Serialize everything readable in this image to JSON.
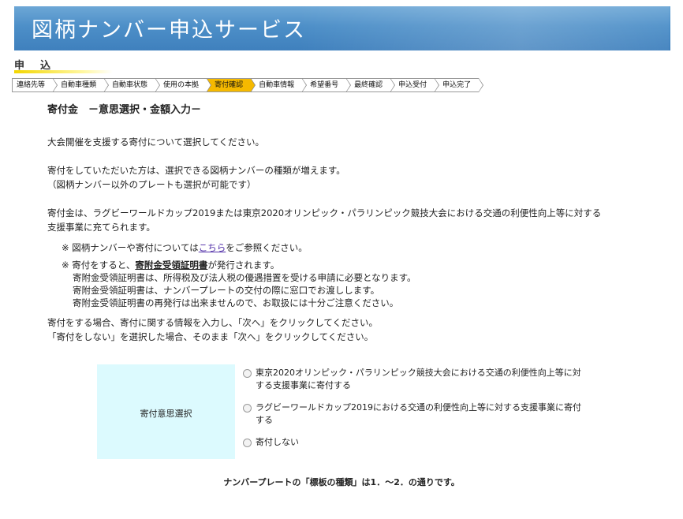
{
  "banner": {
    "title": "図柄ナンバー申込サービス"
  },
  "section": {
    "heading": "申込"
  },
  "steps": [
    {
      "label": "連絡先等",
      "active": false
    },
    {
      "label": "自動車種類",
      "active": false
    },
    {
      "label": "自動車状態",
      "active": false
    },
    {
      "label": "使用の本拠",
      "active": false
    },
    {
      "label": "寄付確認",
      "active": true
    },
    {
      "label": "自動車情報",
      "active": false
    },
    {
      "label": "希望番号",
      "active": false
    },
    {
      "label": "最終確認",
      "active": false
    },
    {
      "label": "申込受付",
      "active": false
    },
    {
      "label": "申込完了",
      "active": false
    }
  ],
  "content": {
    "title": "寄付金　－意思選択・金額入力－",
    "p1": "大会開催を支援する寄付について選択してください。",
    "p2a": "寄付をしていただいた方は、選択できる図柄ナンバーの種類が増えます。",
    "p2b": "（図柄ナンバー以外のプレートも選択が可能です）",
    "p3a": "寄付金は、ラグビーワールドカップ2019または東京2020オリンピック・パラリンピック競技大会における交通の利便性向上等に対する",
    "p3b": "支援事業に充てられます。",
    "note1_pre": "※ 図柄ナンバーや寄付については",
    "note1_link": "こちら",
    "note1_post": "をご参照ください。",
    "note2_pre": "※ 寄付をすると、",
    "note2_bold": "寄附金受領証明書",
    "note2_post": "が発行されます。",
    "note2_l1": "寄附金受領証明書は、所得税及び法人税の優遇措置を受ける申請に必要となります。",
    "note2_l2": "寄附金受領証明書は、ナンバープレートの交付の際に窓口でお渡しします。",
    "note2_l3": "寄附金受領証明書の再発行は出来ませんので、お取扱には十分ご注意ください。",
    "p4a": "寄付をする場合、寄付に関する情報を入力し、「次へ」をクリックしてください。",
    "p4b": "「寄付をしない」を選択した場合、そのまま「次へ」をクリックしてください。"
  },
  "choice": {
    "label": "寄付意思選択",
    "options": [
      {
        "l1": "東京2020オリンピック・パラリンピック競技大会における交通の利便性向上等に対",
        "l2": "する支援事業に寄付する",
        "selected": false
      },
      {
        "l1": "ラグビーワールドカップ2019における交通の利便性向上等に対する支援事業に寄付",
        "l2": "する",
        "selected": false
      },
      {
        "l1": "寄付しない",
        "l2": "",
        "selected": false
      }
    ]
  },
  "footer": {
    "text": "ナンバープレートの「標板の種類」は1．～2．の通りです。"
  }
}
